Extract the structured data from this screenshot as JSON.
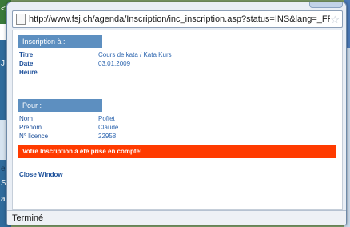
{
  "browser": {
    "url": "http://www.fsj.ch/agenda/Inscription/inc_inscription.asp?status=INS&lang=_FR&ID!",
    "status": "Terminé"
  },
  "inscription": {
    "header": "Inscription à :",
    "fields": [
      {
        "label": "Titre",
        "value": "Cours de kata / Kata Kurs"
      },
      {
        "label": "Date",
        "value": "03.01.2009"
      },
      {
        "label": "Heure",
        "value": ""
      }
    ]
  },
  "pour": {
    "header": "Pour :",
    "fields": [
      {
        "label": "Nom",
        "value": "Poffet"
      },
      {
        "label": "Prénom",
        "value": "Claude"
      },
      {
        "label": "N° licence",
        "value": "22958"
      }
    ]
  },
  "alert": "Votre Inscription à été prise en compte!",
  "close_label": "Close Window",
  "background_tags": [
    "<",
    "J",
    "e",
    "S",
    "a"
  ]
}
